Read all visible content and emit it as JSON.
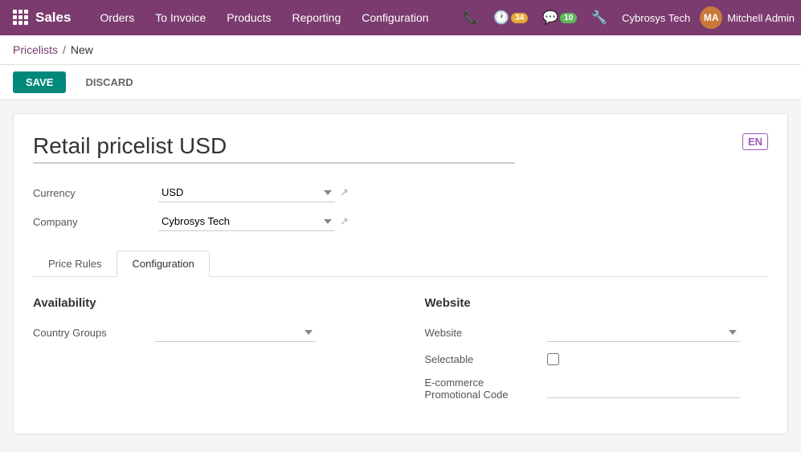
{
  "topbar": {
    "app_name": "Sales",
    "nav_items": [
      {
        "label": "Orders",
        "id": "orders"
      },
      {
        "label": "To Invoice",
        "id": "to-invoice"
      },
      {
        "label": "Products",
        "id": "products"
      },
      {
        "label": "Reporting",
        "id": "reporting"
      },
      {
        "label": "Configuration",
        "id": "configuration"
      }
    ],
    "phone_icon": "📞",
    "clock_badge_count": "34",
    "chat_badge_count": "10",
    "wrench_icon": "🔧",
    "company_name": "Cybrosys Tech",
    "user_name": "Mitchell Admin",
    "user_initials": "MA"
  },
  "breadcrumb": {
    "parent": "Pricelists",
    "separator": "/",
    "current": "New"
  },
  "actions": {
    "save_label": "SAVE",
    "discard_label": "DISCARD"
  },
  "form": {
    "title": "Retail pricelist USD",
    "lang_badge": "EN",
    "fields": {
      "currency_label": "Currency",
      "currency_value": "USD",
      "company_label": "Company",
      "company_value": "Cybrosys Tech"
    },
    "tabs": [
      {
        "label": "Price Rules",
        "id": "price-rules",
        "active": false
      },
      {
        "label": "Configuration",
        "id": "configuration",
        "active": true
      }
    ],
    "tab_configuration": {
      "availability": {
        "section_title": "Availability",
        "country_groups_label": "Country Groups",
        "country_groups_placeholder": ""
      },
      "website": {
        "section_title": "Website",
        "website_label": "Website",
        "website_placeholder": "",
        "selectable_label": "Selectable",
        "ecommerce_label": "E-commerce Promotional Code",
        "ecommerce_placeholder": ""
      }
    }
  }
}
